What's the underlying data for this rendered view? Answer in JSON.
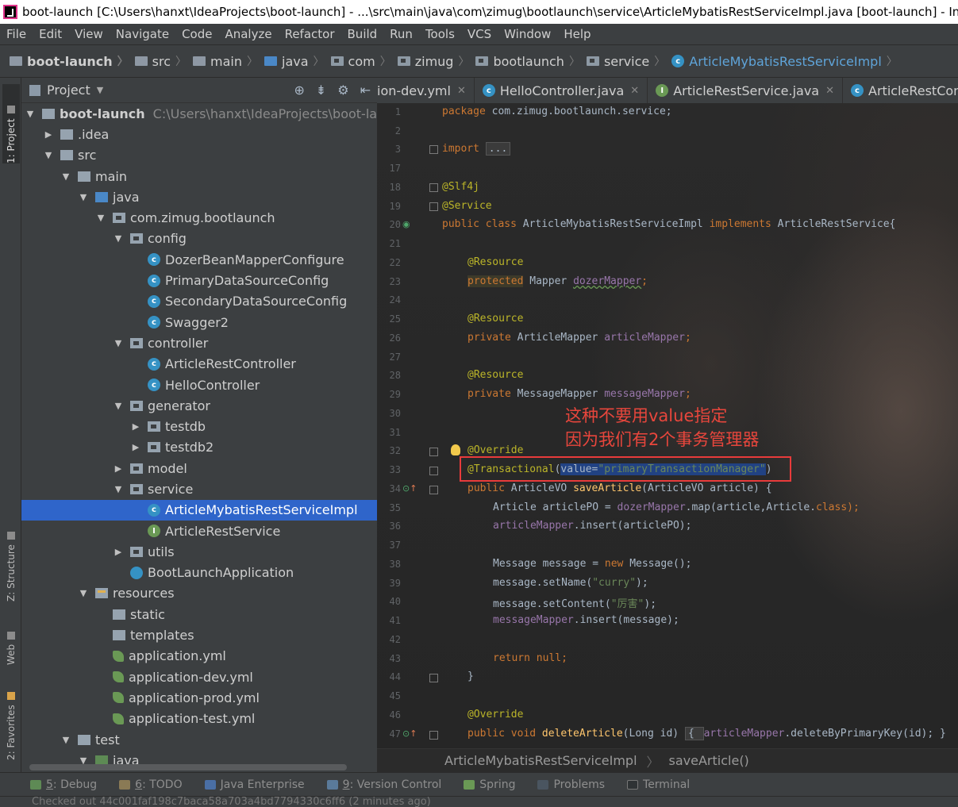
{
  "window": {
    "title": "boot-launch [C:\\Users\\hanxt\\IdeaProjects\\boot-launch] - ...\\src\\main\\java\\com\\zimug\\bootlaunch\\service\\ArticleMybatisRestServiceImpl.java [boot-launch] - IntelliJ IDEA"
  },
  "menu": [
    "File",
    "Edit",
    "View",
    "Navigate",
    "Code",
    "Analyze",
    "Refactor",
    "Build",
    "Run",
    "Tools",
    "VCS",
    "Window",
    "Help"
  ],
  "breadcrumb": [
    "boot-launch",
    "src",
    "main",
    "java",
    "com",
    "zimug",
    "bootlaunch",
    "service",
    "ArticleMybatisRestServiceImpl"
  ],
  "left_strip": {
    "project": "1: Project",
    "structure": "Z: Structure",
    "web": "Web",
    "favorites": "2: Favorites"
  },
  "project_panel": {
    "title": "Project",
    "tree": [
      {
        "label": "boot-launch",
        "path": "C:\\Users\\hanxt\\IdeaProjects\\boot-launch"
      },
      {
        "label": ".idea"
      },
      {
        "label": "src"
      },
      {
        "label": "main"
      },
      {
        "label": "java"
      },
      {
        "label": "com.zimug.bootlaunch"
      },
      {
        "label": "config"
      },
      {
        "label": "DozerBeanMapperConfigure"
      },
      {
        "label": "PrimaryDataSourceConfig"
      },
      {
        "label": "SecondaryDataSourceConfig"
      },
      {
        "label": "Swagger2"
      },
      {
        "label": "controller"
      },
      {
        "label": "ArticleRestController"
      },
      {
        "label": "HelloController"
      },
      {
        "label": "generator"
      },
      {
        "label": "testdb"
      },
      {
        "label": "testdb2"
      },
      {
        "label": "model"
      },
      {
        "label": "service"
      },
      {
        "label": "ArticleMybatisRestServiceImpl"
      },
      {
        "label": "ArticleRestService"
      },
      {
        "label": "utils"
      },
      {
        "label": "BootLaunchApplication"
      },
      {
        "label": "resources"
      },
      {
        "label": "static"
      },
      {
        "label": "templates"
      },
      {
        "label": "application.yml"
      },
      {
        "label": "application-dev.yml"
      },
      {
        "label": "application-prod.yml"
      },
      {
        "label": "application-test.yml"
      },
      {
        "label": "test"
      },
      {
        "label": "java"
      }
    ]
  },
  "editor": {
    "tabs": [
      "ion-dev.yml",
      "HelloController.java",
      "ArticleRestService.java",
      "ArticleRestControlle"
    ],
    "line_numbers": [
      "1",
      "2",
      "3",
      "17",
      "18",
      "19",
      "20",
      "21",
      "22",
      "23",
      "24",
      "25",
      "26",
      "27",
      "28",
      "29",
      "30",
      "31",
      "32",
      "33",
      "34",
      "35",
      "36",
      "37",
      "38",
      "39",
      "40",
      "41",
      "42",
      "43",
      "44",
      "45",
      "46",
      "47"
    ],
    "code": {
      "l1_kw": "package",
      "l1_rest": " com.zimug.bootlaunch.service;",
      "l3_kw": "import",
      "l3_fold": "...",
      "l18": "@Slf4j",
      "l19": "@Service",
      "l20_a": "public class",
      "l20_b": " ArticleMybatisRestServiceImpl ",
      "l20_c": "implements",
      "l20_d": " ArticleRestService{",
      "l22": "@Resource",
      "l23_a": "protected",
      "l23_b": " Mapper ",
      "l23_c": "dozerMapper",
      "l23_d": ";",
      "l25": "@Resource",
      "l26_a": "private",
      "l26_b": " ArticleMapper ",
      "l26_c": "articleMapper",
      "l26_d": ";",
      "l28": "@Resource",
      "l29_a": "private",
      "l29_b": " MessageMapper ",
      "l29_c": "messageMapper",
      "l29_d": ";",
      "l32": "@Override",
      "l33_a": "@Transactional",
      "l33_b": "(",
      "l33_c": "value=",
      "l33_d": "\"primaryTransactionManager\"",
      "l33_e": ")",
      "l34_a": "public",
      "l34_b": " ArticleVO ",
      "l34_c": "saveArticle",
      "l34_d": "(ArticleVO article) {",
      "l35_a": "Article articlePO = ",
      "l35_b": "dozerMapper",
      "l35_c": ".map(article,Article.",
      "l35_d": "class",
      "l35_e": ");",
      "l36_a": "articleMapper",
      "l36_b": ".insert(articlePO);",
      "l38_a": "Message message = ",
      "l38_b": "new",
      "l38_c": " Message();",
      "l39_a": "message.setName(",
      "l39_b": "\"curry\"",
      "l39_c": ");",
      "l40_a": "message.setContent(",
      "l40_b": "\"厉害\"",
      "l40_c": ");",
      "l41_a": "messageMapper",
      "l41_b": ".insert(message);",
      "l43_a": "return null",
      "l43_b": ";",
      "l44": "}",
      "l46": "@Override",
      "l47_a": "public void",
      "l47_b": " deleteArticle",
      "l47_c": "(Long id) ",
      "l47_d": "{ ",
      "l47_e": "articleMapper",
      "l47_f": ".deleteByPrimaryKey(id); }"
    },
    "annotation": {
      "line1": "这种不要用value指定",
      "line2": "因为我们有2个事务管理器"
    },
    "footer_breadcrumb": [
      "ArticleMybatisRestServiceImpl",
      "saveArticle()"
    ]
  },
  "bottom_tools": [
    {
      "key": "5",
      "label": ": Debug"
    },
    {
      "key": "6",
      "label": ": TODO"
    },
    {
      "key": "",
      "label": "Java Enterprise"
    },
    {
      "key": "9",
      "label": ": Version Control"
    },
    {
      "key": "",
      "label": "Spring"
    },
    {
      "key": "",
      "label": "Problems"
    },
    {
      "key": "",
      "label": "Terminal"
    }
  ],
  "status": "Checked out 44c001faf198c7baca58a703a4bd7794330c6ff6 (2 minutes ago)",
  "colors": {
    "keyword": "#cc7832",
    "annotation": "#bbb529",
    "field": "#9876aa",
    "string": "#6a8759",
    "method": "#ffc66d",
    "selection": "#2f65ca",
    "highlight_box": "#e83b3b"
  }
}
